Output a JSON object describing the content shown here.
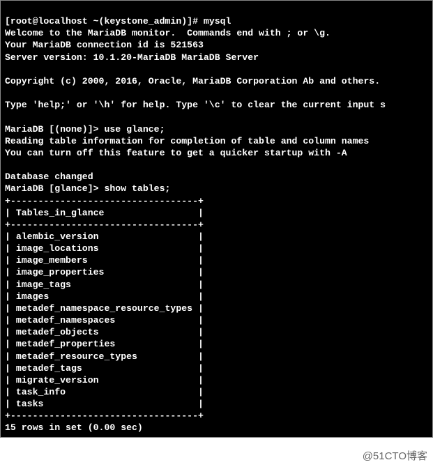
{
  "terminal": {
    "prompt1": "[root@localhost ~(keystone_admin)]# ",
    "cmd1": "mysql",
    "welcome1": "Welcome to the MariaDB monitor.  Commands end with ; or \\g.",
    "welcome2": "Your MariaDB connection id is 521563",
    "welcome3": "Server version: 10.1.20-MariaDB MariaDB Server",
    "copyright": "Copyright (c) 2000, 2016, Oracle, MariaDB Corporation Ab and others.",
    "help": "Type 'help;' or '\\h' for help. Type '\\c' to clear the current input s",
    "prompt2": "MariaDB [(none)]> ",
    "cmd2": "use glance;",
    "reading1": "Reading table information for completion of table and column names",
    "reading2": "You can turn off this feature to get a quicker startup with -A",
    "dbchanged": "Database changed",
    "prompt3": "MariaDB [glance]> ",
    "cmd3": "show tables;",
    "border": "+----------------------------------+",
    "header": "| Tables_in_glance                 |",
    "rows": [
      "| alembic_version                  |",
      "| image_locations                  |",
      "| image_members                    |",
      "| image_properties                 |",
      "| image_tags                       |",
      "| images                           |",
      "| metadef_namespace_resource_types |",
      "| metadef_namespaces               |",
      "| metadef_objects                  |",
      "| metadef_properties               |",
      "| metadef_resource_types           |",
      "| metadef_tags                     |",
      "| migrate_version                  |",
      "| task_info                        |",
      "| tasks                            |"
    ],
    "summary": "15 rows in set (0.00 sec)"
  },
  "chart_data": {
    "type": "table",
    "title": "Tables_in_glance",
    "categories": [
      "Tables_in_glance"
    ],
    "values": [
      "alembic_version",
      "image_locations",
      "image_members",
      "image_properties",
      "image_tags",
      "images",
      "metadef_namespace_resource_types",
      "metadef_namespaces",
      "metadef_objects",
      "metadef_properties",
      "metadef_resource_types",
      "metadef_tags",
      "migrate_version",
      "task_info",
      "tasks"
    ],
    "row_count": 15,
    "duration_sec": 0.0
  },
  "watermark": "@51CTO博客"
}
